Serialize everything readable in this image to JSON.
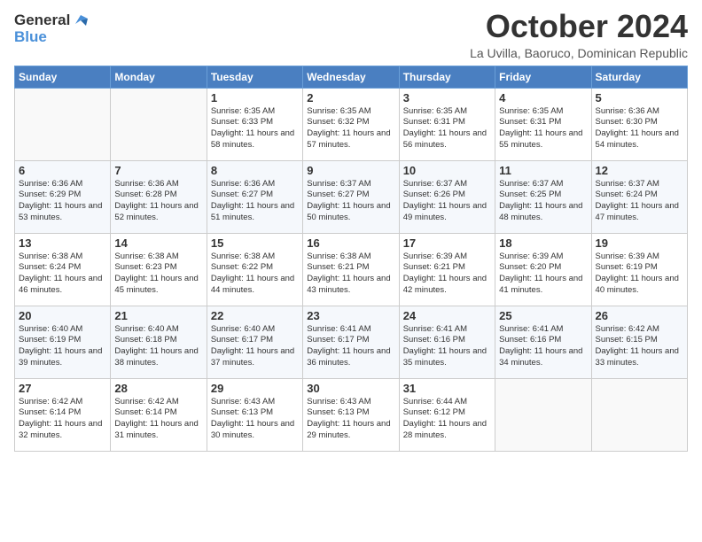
{
  "logo": {
    "line1": "General",
    "line2": "Blue"
  },
  "header": {
    "month": "October 2024",
    "location": "La Uvilla, Baoruco, Dominican Republic"
  },
  "weekdays": [
    "Sunday",
    "Monday",
    "Tuesday",
    "Wednesday",
    "Thursday",
    "Friday",
    "Saturday"
  ],
  "weeks": [
    [
      {
        "day": "",
        "sunrise": "",
        "sunset": "",
        "daylight": ""
      },
      {
        "day": "",
        "sunrise": "",
        "sunset": "",
        "daylight": ""
      },
      {
        "day": "1",
        "sunrise": "Sunrise: 6:35 AM",
        "sunset": "Sunset: 6:33 PM",
        "daylight": "Daylight: 11 hours and 58 minutes."
      },
      {
        "day": "2",
        "sunrise": "Sunrise: 6:35 AM",
        "sunset": "Sunset: 6:32 PM",
        "daylight": "Daylight: 11 hours and 57 minutes."
      },
      {
        "day": "3",
        "sunrise": "Sunrise: 6:35 AM",
        "sunset": "Sunset: 6:31 PM",
        "daylight": "Daylight: 11 hours and 56 minutes."
      },
      {
        "day": "4",
        "sunrise": "Sunrise: 6:35 AM",
        "sunset": "Sunset: 6:31 PM",
        "daylight": "Daylight: 11 hours and 55 minutes."
      },
      {
        "day": "5",
        "sunrise": "Sunrise: 6:36 AM",
        "sunset": "Sunset: 6:30 PM",
        "daylight": "Daylight: 11 hours and 54 minutes."
      }
    ],
    [
      {
        "day": "6",
        "sunrise": "Sunrise: 6:36 AM",
        "sunset": "Sunset: 6:29 PM",
        "daylight": "Daylight: 11 hours and 53 minutes."
      },
      {
        "day": "7",
        "sunrise": "Sunrise: 6:36 AM",
        "sunset": "Sunset: 6:28 PM",
        "daylight": "Daylight: 11 hours and 52 minutes."
      },
      {
        "day": "8",
        "sunrise": "Sunrise: 6:36 AM",
        "sunset": "Sunset: 6:27 PM",
        "daylight": "Daylight: 11 hours and 51 minutes."
      },
      {
        "day": "9",
        "sunrise": "Sunrise: 6:37 AM",
        "sunset": "Sunset: 6:27 PM",
        "daylight": "Daylight: 11 hours and 50 minutes."
      },
      {
        "day": "10",
        "sunrise": "Sunrise: 6:37 AM",
        "sunset": "Sunset: 6:26 PM",
        "daylight": "Daylight: 11 hours and 49 minutes."
      },
      {
        "day": "11",
        "sunrise": "Sunrise: 6:37 AM",
        "sunset": "Sunset: 6:25 PM",
        "daylight": "Daylight: 11 hours and 48 minutes."
      },
      {
        "day": "12",
        "sunrise": "Sunrise: 6:37 AM",
        "sunset": "Sunset: 6:24 PM",
        "daylight": "Daylight: 11 hours and 47 minutes."
      }
    ],
    [
      {
        "day": "13",
        "sunrise": "Sunrise: 6:38 AM",
        "sunset": "Sunset: 6:24 PM",
        "daylight": "Daylight: 11 hours and 46 minutes."
      },
      {
        "day": "14",
        "sunrise": "Sunrise: 6:38 AM",
        "sunset": "Sunset: 6:23 PM",
        "daylight": "Daylight: 11 hours and 45 minutes."
      },
      {
        "day": "15",
        "sunrise": "Sunrise: 6:38 AM",
        "sunset": "Sunset: 6:22 PM",
        "daylight": "Daylight: 11 hours and 44 minutes."
      },
      {
        "day": "16",
        "sunrise": "Sunrise: 6:38 AM",
        "sunset": "Sunset: 6:21 PM",
        "daylight": "Daylight: 11 hours and 43 minutes."
      },
      {
        "day": "17",
        "sunrise": "Sunrise: 6:39 AM",
        "sunset": "Sunset: 6:21 PM",
        "daylight": "Daylight: 11 hours and 42 minutes."
      },
      {
        "day": "18",
        "sunrise": "Sunrise: 6:39 AM",
        "sunset": "Sunset: 6:20 PM",
        "daylight": "Daylight: 11 hours and 41 minutes."
      },
      {
        "day": "19",
        "sunrise": "Sunrise: 6:39 AM",
        "sunset": "Sunset: 6:19 PM",
        "daylight": "Daylight: 11 hours and 40 minutes."
      }
    ],
    [
      {
        "day": "20",
        "sunrise": "Sunrise: 6:40 AM",
        "sunset": "Sunset: 6:19 PM",
        "daylight": "Daylight: 11 hours and 39 minutes."
      },
      {
        "day": "21",
        "sunrise": "Sunrise: 6:40 AM",
        "sunset": "Sunset: 6:18 PM",
        "daylight": "Daylight: 11 hours and 38 minutes."
      },
      {
        "day": "22",
        "sunrise": "Sunrise: 6:40 AM",
        "sunset": "Sunset: 6:17 PM",
        "daylight": "Daylight: 11 hours and 37 minutes."
      },
      {
        "day": "23",
        "sunrise": "Sunrise: 6:41 AM",
        "sunset": "Sunset: 6:17 PM",
        "daylight": "Daylight: 11 hours and 36 minutes."
      },
      {
        "day": "24",
        "sunrise": "Sunrise: 6:41 AM",
        "sunset": "Sunset: 6:16 PM",
        "daylight": "Daylight: 11 hours and 35 minutes."
      },
      {
        "day": "25",
        "sunrise": "Sunrise: 6:41 AM",
        "sunset": "Sunset: 6:16 PM",
        "daylight": "Daylight: 11 hours and 34 minutes."
      },
      {
        "day": "26",
        "sunrise": "Sunrise: 6:42 AM",
        "sunset": "Sunset: 6:15 PM",
        "daylight": "Daylight: 11 hours and 33 minutes."
      }
    ],
    [
      {
        "day": "27",
        "sunrise": "Sunrise: 6:42 AM",
        "sunset": "Sunset: 6:14 PM",
        "daylight": "Daylight: 11 hours and 32 minutes."
      },
      {
        "day": "28",
        "sunrise": "Sunrise: 6:42 AM",
        "sunset": "Sunset: 6:14 PM",
        "daylight": "Daylight: 11 hours and 31 minutes."
      },
      {
        "day": "29",
        "sunrise": "Sunrise: 6:43 AM",
        "sunset": "Sunset: 6:13 PM",
        "daylight": "Daylight: 11 hours and 30 minutes."
      },
      {
        "day": "30",
        "sunrise": "Sunrise: 6:43 AM",
        "sunset": "Sunset: 6:13 PM",
        "daylight": "Daylight: 11 hours and 29 minutes."
      },
      {
        "day": "31",
        "sunrise": "Sunrise: 6:44 AM",
        "sunset": "Sunset: 6:12 PM",
        "daylight": "Daylight: 11 hours and 28 minutes."
      },
      {
        "day": "",
        "sunrise": "",
        "sunset": "",
        "daylight": ""
      },
      {
        "day": "",
        "sunrise": "",
        "sunset": "",
        "daylight": ""
      }
    ]
  ]
}
